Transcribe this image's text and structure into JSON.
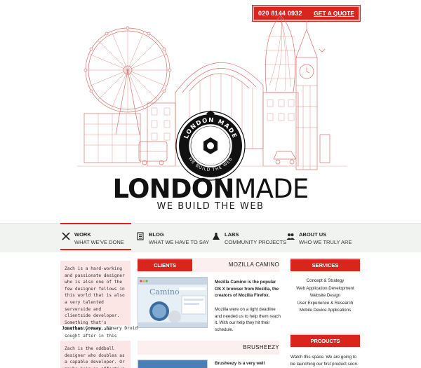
{
  "header": {
    "phone": "020 8144 0932",
    "quote_link": "GET A QUOTE"
  },
  "badge": {
    "top_text": "LONDON MADE",
    "bottom_text": "WE BUILD THE WEB"
  },
  "brand": {
    "bold": "LONDON",
    "light": "MADE",
    "tagline": "WE BUILD THE WEB"
  },
  "nav": [
    {
      "title": "WORK",
      "sub": "WHAT WE'VE DONE",
      "icon": "tools-icon"
    },
    {
      "title": "BLOG",
      "sub": "WHAT WE HAVE TO SAY",
      "icon": "notepad-icon"
    },
    {
      "title": "LABS",
      "sub": "COMMUNITY PROJECTS",
      "icon": "flask-icon"
    },
    {
      "title": "ABOUT US",
      "sub": "WHO WE TRULY ARE",
      "icon": "people-icon"
    }
  ],
  "testimonials": {
    "quote1": "Zach is a hard-working and passionate designer who is also one of the few designer fellows in this world that is also a very talented serverside and clientside developer. Something that's extremely rare and sought after in this industry!",
    "cite1_name": "Jonathan Conway",
    "cite1_company": ", Binary Droid",
    "quote2": "Zach is the oddball designer who doubles as a capable developer. Or maybe he's an effective developer who also"
  },
  "clients": {
    "tab_label": "CLIENTS",
    "client1_name": "MOZILLA CAMINO",
    "client1_bold": "Mozilla Camino is the popular OS X browser from Mozilla, the creators of Mozilla Firefox.",
    "client1_desc": "Mozilla were on a tight deadline and needed us to help them reach it. With our help they hit their schedule.",
    "shot1_title": "Camino",
    "client2_name": "BRUSHEEZY",
    "client2_bold": "Brusheezy is a very well"
  },
  "services": {
    "tab_label": "SERVICES",
    "items": [
      "Concept & Strategy",
      "Web Application Development",
      "Website Design",
      "User Experience & Research",
      "Mobile Device Applications"
    ]
  },
  "products": {
    "tab_label": "PRODUCTS",
    "text": "Watch this space. We are going to be launching our first product soon."
  },
  "colors": {
    "accent": "#d8261c",
    "pink_panel": "#fce5e5",
    "nav_band": "#f1f3f1"
  }
}
